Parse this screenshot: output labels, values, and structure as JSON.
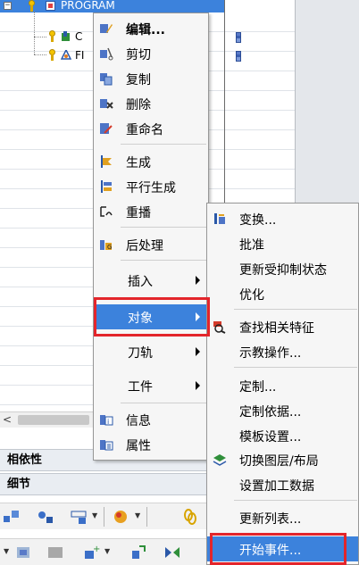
{
  "navigator": {
    "program_label": "PROGRAM",
    "children": [
      {
        "label": "C"
      },
      {
        "label": "FI"
      }
    ],
    "toggle_symbol": "−",
    "scroll_left_arrow": "<"
  },
  "panels": {
    "dependencies": "相依性",
    "details": "细节"
  },
  "context_menu": {
    "items": [
      {
        "label": "编辑...",
        "icon": "edit-icon"
      },
      {
        "label": "剪切",
        "icon": "cut-icon"
      },
      {
        "label": "复制",
        "icon": "copy-icon"
      },
      {
        "label": "删除",
        "icon": "delete-icon"
      },
      {
        "label": "重命名",
        "icon": "rename-icon"
      },
      {
        "label": "生成",
        "icon": "generate-icon"
      },
      {
        "label": "平行生成",
        "icon": "parallel-generate-icon"
      },
      {
        "label": "重播",
        "icon": "replay-icon"
      },
      {
        "label": "后处理",
        "icon": "postprocess-icon"
      },
      {
        "label": "插入",
        "icon": ""
      },
      {
        "label": "对象",
        "icon": ""
      },
      {
        "label": "刀轨",
        "icon": ""
      },
      {
        "label": "工件",
        "icon": ""
      },
      {
        "label": "信息",
        "icon": "info-icon"
      },
      {
        "label": "属性",
        "icon": "properties-icon"
      }
    ]
  },
  "submenu": {
    "items": [
      {
        "label": "变换...",
        "icon": "transform-icon"
      },
      {
        "label": "批准",
        "icon": ""
      },
      {
        "label": "更新受抑制状态",
        "icon": ""
      },
      {
        "label": "优化",
        "icon": ""
      },
      {
        "label": "查找相关特征",
        "icon": "find-features-icon"
      },
      {
        "label": "示教操作...",
        "icon": ""
      },
      {
        "label": "定制...",
        "icon": ""
      },
      {
        "label": "定制依据...",
        "icon": ""
      },
      {
        "label": "模板设置...",
        "icon": ""
      },
      {
        "label": "切换图层/布局",
        "icon": "layer-switch-icon"
      },
      {
        "label": "设置加工数据",
        "icon": ""
      },
      {
        "label": "更新列表...",
        "icon": ""
      },
      {
        "label": "开始事件...",
        "icon": ""
      }
    ]
  },
  "colors": {
    "highlight": "#3c82dc",
    "callout": "#e3252b"
  }
}
